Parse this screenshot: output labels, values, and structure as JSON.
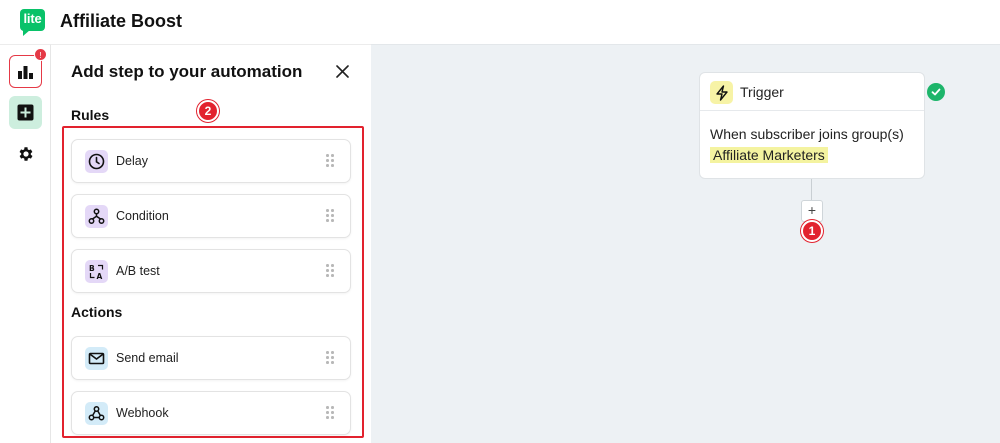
{
  "app": {
    "logo_text": "lite",
    "title": "Affiliate Boost",
    "brand_color": "#09c269"
  },
  "rail": {
    "items": [
      {
        "name": "stats-button",
        "icon": "bar-chart-icon",
        "badge": "!"
      },
      {
        "name": "add-step-button",
        "icon": "plus-square-icon",
        "active": true
      },
      {
        "name": "settings-button",
        "icon": "gear-icon"
      }
    ]
  },
  "panel": {
    "title": "Add step to your automation",
    "close_icon": "close-icon",
    "rules_label": "Rules",
    "actions_label": "Actions",
    "rules": [
      {
        "label": "Delay",
        "icon": "clock-icon"
      },
      {
        "label": "Condition",
        "icon": "branch-icon"
      },
      {
        "label": "A/B test",
        "icon": "ab-test-icon"
      }
    ],
    "actions": [
      {
        "label": "Send email",
        "icon": "envelope-icon"
      },
      {
        "label": "Webhook",
        "icon": "webhook-icon"
      }
    ],
    "callout": "2"
  },
  "canvas": {
    "trigger": {
      "title": "Trigger",
      "icon": "lightning-icon",
      "text": "When subscriber joins group(s)",
      "group": "Affiliate Marketers",
      "status": "check-circle-icon"
    },
    "add_button": "+",
    "callout": "1"
  },
  "colors": {
    "highlight": "#e2222e",
    "success": "#1db56a",
    "canvas_bg": "#edf1f4"
  }
}
